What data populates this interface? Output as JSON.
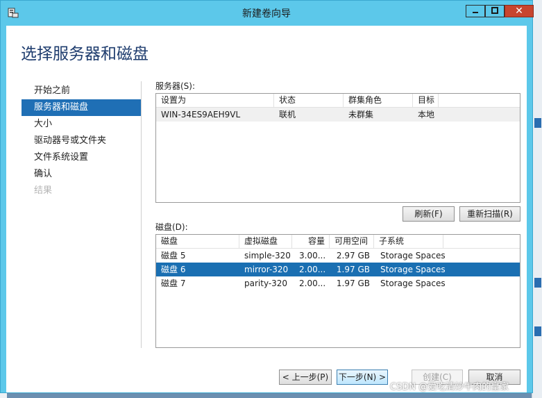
{
  "window": {
    "title": "新建卷向导",
    "close_glyph": "✕"
  },
  "heading": "选择服务器和磁盘",
  "nav": {
    "items": [
      {
        "label": "开始之前"
      },
      {
        "label": "服务器和磁盘"
      },
      {
        "label": "大小"
      },
      {
        "label": "驱动器号或文件夹"
      },
      {
        "label": "文件系统设置"
      },
      {
        "label": "确认"
      },
      {
        "label": "结果"
      }
    ],
    "active_index": 1
  },
  "servers": {
    "label": "服务器(S):",
    "columns": [
      "设置为",
      "状态",
      "群集角色",
      "目标",
      ""
    ],
    "rows": [
      {
        "name": "WIN-34ES9AEH9VL",
        "status": "联机",
        "cluster_role": "未群集",
        "target": "本地"
      }
    ]
  },
  "buttons": {
    "refresh": "刷新(F)",
    "rescan": "重新扫描(R)",
    "prev": "< 上一步(P)",
    "next": "下一步(N) >",
    "create": "创建(C)",
    "cancel": "取消"
  },
  "disks": {
    "label": "磁盘(D):",
    "columns": [
      "磁盘",
      "虚拟磁盘",
      "容量",
      "可用空间",
      "子系统",
      ""
    ],
    "rows": [
      {
        "disk": "磁盘 5",
        "virtual_disk": "simple-320",
        "capacity": "3.00...",
        "free": "2.97 GB",
        "subsystem": "Storage Spaces",
        "selected": false
      },
      {
        "disk": "磁盘 6",
        "virtual_disk": "mirror-320",
        "capacity": "2.00...",
        "free": "1.97 GB",
        "subsystem": "Storage Spaces",
        "selected": true
      },
      {
        "disk": "磁盘 7",
        "virtual_disk": "parity-320",
        "capacity": "2.00...",
        "free": "1.97 GB",
        "subsystem": "Storage Spaces",
        "selected": false
      }
    ]
  },
  "watermark": "CSDN @爱吃清炒牛肉的皇家",
  "colors": {
    "titlebar": "#5cc8ea",
    "selection": "#1a6fb2",
    "heading": "#1e3c6e"
  }
}
